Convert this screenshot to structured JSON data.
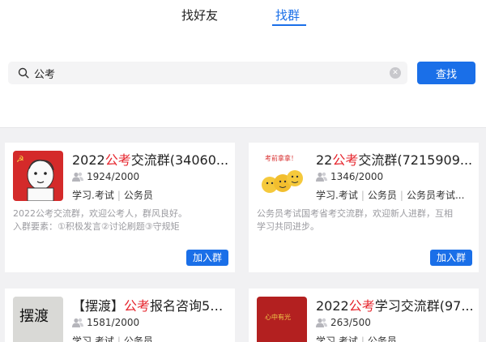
{
  "tabs": [
    {
      "label": "找好友"
    },
    {
      "label": "找群"
    }
  ],
  "search": {
    "value": "公考",
    "clear_icon": "clear-icon",
    "button_label": "查找"
  },
  "groups": [
    {
      "name_prefix": "2022",
      "name_highlight": "公考",
      "name_suffix": "交流群(34060...",
      "members": "1924/2000",
      "tag1": "学习.考试",
      "tag2": "公务员",
      "tag3": "",
      "desc_line1": "2022公考交流群，欢迎公考人，群风良好。",
      "desc_line2": "入群要素：①积极发言②讨论刷题③守规矩",
      "join_label": "加入群"
    },
    {
      "name_prefix": "22",
      "name_highlight": "公考",
      "name_suffix": "交流群(7215909...",
      "members": "1346/2000",
      "tag1": "学习.考试",
      "tag2": "公务员",
      "tag3": "公务员考试...",
      "desc_line1": "公务员考试国考省考交流群，欢迎新人进群，互相",
      "desc_line2": "学习共同进步。",
      "avatar_text": "考前拿拿！",
      "join_label": "加入群"
    },
    {
      "name_prefix": "【摆渡】",
      "name_highlight": "公考",
      "name_suffix": "报名咨询5群...",
      "members": "1581/2000",
      "tag1": "学习.考试",
      "tag2": "公务员",
      "avatar_text": "摆渡"
    },
    {
      "name_prefix": "2022",
      "name_highlight": "公考",
      "name_suffix": "学习交流群(97...",
      "members": "263/500",
      "tag1": "学习.考试",
      "tag2": "公务员",
      "avatar_text": "心中有光"
    }
  ],
  "colors": {
    "accent": "#1a6fe8",
    "highlight": "#e6252d",
    "description": "#9b9ba0"
  }
}
